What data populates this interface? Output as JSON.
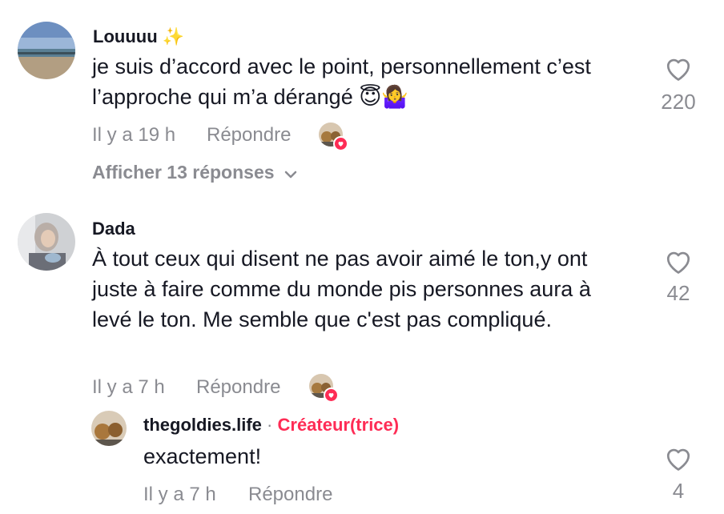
{
  "comments": [
    {
      "username": "Louuuu ✨",
      "text": "je suis d’accord avec le point, personnellement c’est l’approche qui m’a dérangé 😇🤷‍♀️",
      "time": "Il y a 19 h",
      "reply_label": "Répondre",
      "likes": "220",
      "view_replies": "Afficher 13 réponses"
    },
    {
      "username": "Dada",
      "text": "À tout ceux qui disent ne pas avoir aimé le ton,y ont juste à faire comme du monde pis personnes aura à levé le ton. Me semble que c'est pas compliqué.",
      "time": "Il y a 7 h",
      "reply_label": "Répondre",
      "likes": "42",
      "reply": {
        "username": "thegoldies.life",
        "separator": "·",
        "creator_label": "Créateur(trice)",
        "text": "exactement!",
        "time": "Il y a 7 h",
        "reply_label": "Répondre",
        "likes": "4"
      }
    }
  ],
  "colors": {
    "accent": "#fe2c55",
    "muted": "#8a8b91",
    "text": "#161823"
  },
  "icons": {
    "like": "heart-outline-icon",
    "expand": "chevron-down-icon",
    "creator_liked": "heart-badge-icon"
  }
}
